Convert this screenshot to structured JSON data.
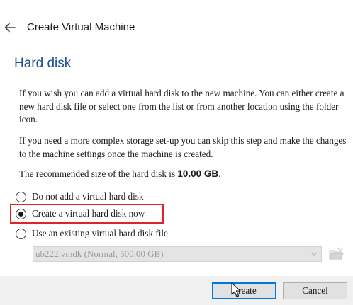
{
  "header": {
    "title": "Create Virtual Machine",
    "back_icon": "arrow-left-icon"
  },
  "page": {
    "heading": "Hard disk",
    "paragraph_1": "If you wish you can add a virtual hard disk to the new machine. You can either create a new hard disk file or select one from the list or from another location using the folder icon.",
    "paragraph_2": "If you need a more complex storage set-up you can skip this step and make the changes to the machine settings once the machine is created.",
    "recommended_prefix": "The recommended size of the hard disk is ",
    "recommended_size": "10.00 GB",
    "recommended_suffix": "."
  },
  "options": {
    "no_disk": "Do not add a virtual hard disk",
    "create_now": "Create a virtual hard disk now",
    "use_existing": "Use an existing virtual hard disk file",
    "selected": "create_now"
  },
  "existing_disk": {
    "value": "ub222.vmdk (Normal, 500.00 GB)",
    "enabled": false,
    "folder_icon": "folder-open-icon"
  },
  "buttons": {
    "create": "Create",
    "cancel": "Cancel"
  },
  "colors": {
    "heading": "#1d4f91",
    "highlight": "#e0232b",
    "default_button_border": "#0078d7"
  }
}
